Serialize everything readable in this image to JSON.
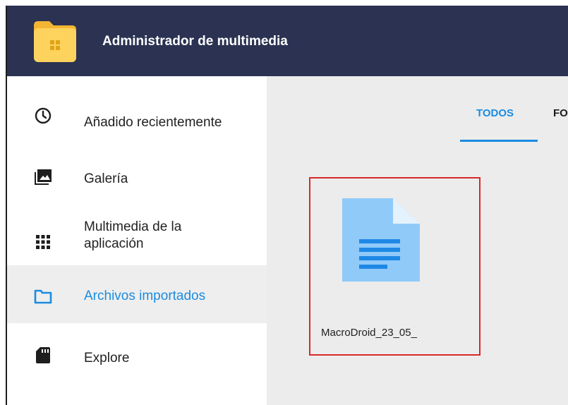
{
  "app": {
    "title": "Administrador de multimedia",
    "logo_icon": "windows-folder-icon"
  },
  "sidebar": {
    "items": [
      {
        "label": "Añadido recientemente",
        "icon": "clock-icon",
        "active": false
      },
      {
        "label": "Galería",
        "icon": "gallery-icon",
        "active": false
      },
      {
        "label": "Multimedia de la aplicación",
        "icon": "grid-icon",
        "active": false
      },
      {
        "label": "Archivos importados",
        "icon": "folder-icon",
        "active": true
      },
      {
        "label": "Explore",
        "icon": "sd-card-icon",
        "active": false
      }
    ]
  },
  "tabs": [
    {
      "label": "TODOS",
      "selected": true
    },
    {
      "label": "FO",
      "selected": false
    }
  ],
  "files": [
    {
      "name": "MacroDroid_23_05_",
      "icon": "document-icon",
      "highlighted": true
    }
  ],
  "colors": {
    "header_bg": "#2b3252",
    "accent": "#1a8ce0",
    "content_bg": "#ececec",
    "highlight_border": "#d92828",
    "doc_icon": "#90caf9"
  }
}
